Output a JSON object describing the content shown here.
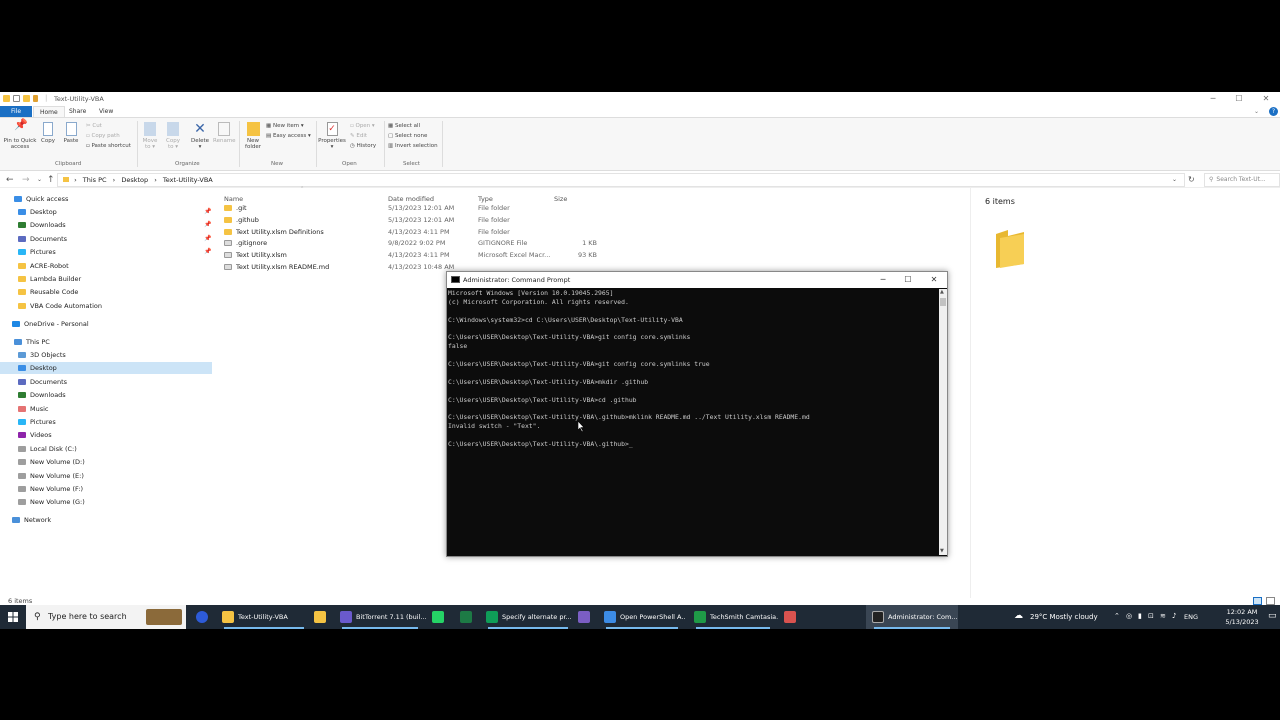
{
  "window": {
    "title": "Text-Utility-VBA"
  },
  "ribbon_tabs": [
    "File",
    "Home",
    "Share",
    "View"
  ],
  "ribbon": {
    "pin_label_1": "Pin to Quick",
    "pin_label_2": "access",
    "copy": "Copy",
    "paste": "Paste",
    "cut": "Cut",
    "copy_path": "Copy path",
    "paste_shortcut": "Paste shortcut",
    "move_to_1": "Move",
    "move_to_2": "to ▾",
    "copy_to_1": "Copy",
    "copy_to_2": "to ▾",
    "delete_1": "Delete",
    "delete_2": "▾",
    "rename": "Rename",
    "new_folder_1": "New",
    "new_folder_2": "folder",
    "new_item": "New item ▾",
    "easy_access": "Easy access ▾",
    "properties_1": "Properties",
    "properties_2": "▾",
    "open": "Open ▾",
    "edit": "Edit",
    "history": "History",
    "select_all": "Select all",
    "select_none": "Select none",
    "invert_selection": "Invert selection",
    "groups": [
      "Clipboard",
      "Organize",
      "New",
      "Open",
      "Select"
    ]
  },
  "address": {
    "breadcrumb": [
      "This PC",
      "Desktop",
      "Text-Utility-VBA"
    ],
    "search_placeholder": "Search Text-Ut..."
  },
  "nav": {
    "quick_access": "Quick access",
    "quick_items": [
      "Desktop",
      "Downloads",
      "Documents",
      "Pictures",
      "ACRE-Robot",
      "Lambda Builder",
      "Reusable Code",
      "VBA Code Automation"
    ],
    "onedrive": "OneDrive - Personal",
    "this_pc": "This PC",
    "pc_items": [
      "3D Objects",
      "Desktop",
      "Documents",
      "Downloads",
      "Music",
      "Pictures",
      "Videos",
      "Local Disk (C:)",
      "New Volume (D:)",
      "New Volume (E:)",
      "New Volume (F:)",
      "New Volume (G:)"
    ],
    "network": "Network"
  },
  "columns": [
    "Name",
    "Date modified",
    "Type",
    "Size"
  ],
  "files": [
    {
      "name": ".git",
      "date": "5/13/2023 12:01 AM",
      "type": "File folder",
      "size": ""
    },
    {
      "name": ".github",
      "date": "5/13/2023 12:01 AM",
      "type": "File folder",
      "size": ""
    },
    {
      "name": "Text Utility.xlsm Definitions",
      "date": "4/13/2023 4:11 PM",
      "type": "File folder",
      "size": ""
    },
    {
      "name": ".gitignore",
      "date": "9/8/2022 9:02 PM",
      "type": "GITIGNORE File",
      "size": "1 KB"
    },
    {
      "name": "Text Utility.xlsm",
      "date": "4/13/2023 4:11 PM",
      "type": "Microsoft Excel Macr...",
      "size": "93 KB"
    },
    {
      "name": "Text Utility.xlsm README.md",
      "date": "4/13/2023 10:48 AM",
      "type": "",
      "size": ""
    }
  ],
  "preview": {
    "count": "6 items"
  },
  "status": {
    "count": "6 items"
  },
  "cmd": {
    "title": "Administrator: Command Prompt",
    "lines": [
      "Microsoft Windows [Version 10.0.19045.2965]",
      "(c) Microsoft Corporation. All rights reserved.",
      "",
      "C:\\Windows\\system32>cd C:\\Users\\USER\\Desktop\\Text-Utility-VBA",
      "",
      "C:\\Users\\USER\\Desktop\\Text-Utility-VBA>git config core.symlinks",
      "false",
      "",
      "C:\\Users\\USER\\Desktop\\Text-Utility-VBA>git config core.symlinks true",
      "",
      "C:\\Users\\USER\\Desktop\\Text-Utility-VBA>mkdir .github",
      "",
      "C:\\Users\\USER\\Desktop\\Text-Utility-VBA>cd .github",
      "",
      "C:\\Users\\USER\\Desktop\\Text-Utility-VBA\\.github>mklink README.md ../Text Utility.xlsm README.md",
      "Invalid switch - \"Text\".",
      "",
      "C:\\Users\\USER\\Desktop\\Text-Utility-VBA\\.github>_"
    ]
  },
  "taskbar": {
    "search_placeholder": "Type here to search",
    "items": [
      "Text-Utility-VBA",
      "BitTorrent 7.11  (buil...",
      "Specify alternate pr...",
      "Open PowerShell A...",
      "TechSmith Camtasia...",
      "Administrator: Com..."
    ],
    "weather": "29°C  Mostly cloudy",
    "lang": "ENG",
    "time": "12:02 AM",
    "date": "5/13/2023"
  },
  "colors": {
    "accent": "#1a6fc4",
    "selection": "#cce4f7",
    "folder": "#f5c343",
    "terminal_bg": "#0c0c0c",
    "taskbar_bg": "#1f2a36"
  }
}
